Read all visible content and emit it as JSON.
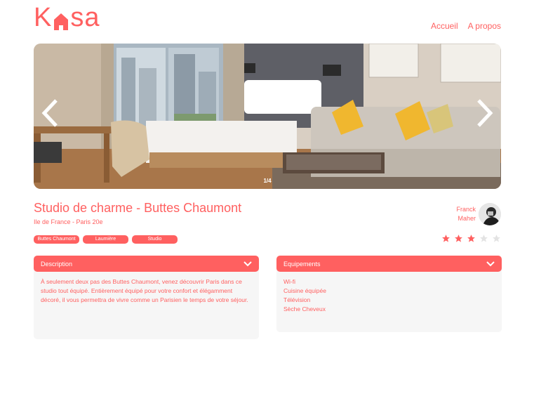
{
  "brand": {
    "logo_left": "K",
    "logo_right": "sa",
    "color": "#FF6060"
  },
  "nav": {
    "home": "Accueil",
    "about": "A propos"
  },
  "gallery": {
    "counter": "1/4"
  },
  "listing": {
    "title": "Studio de charme - Buttes Chaumont",
    "location": "Ile de France - Paris 20e",
    "tags": [
      "Buttes Chaumont",
      "Laumière",
      "Studio"
    ]
  },
  "host": {
    "first_name": "Franck",
    "last_name": "Maher"
  },
  "rating": {
    "value": 3,
    "max": 5
  },
  "description": {
    "label": "Description",
    "text": "À seulement deux pas des Buttes Chaumont, venez découvrir Paris dans ce studio tout équipé. Entièrement équipé pour votre confort et élégamment décoré, il vous permettra de vivre comme un Parisien le temps de votre séjour."
  },
  "equipments": {
    "label": "Equipements",
    "items": [
      "Wi-fi",
      "Cuisine équipée",
      "Télévision",
      "Sèche Cheveux"
    ]
  }
}
